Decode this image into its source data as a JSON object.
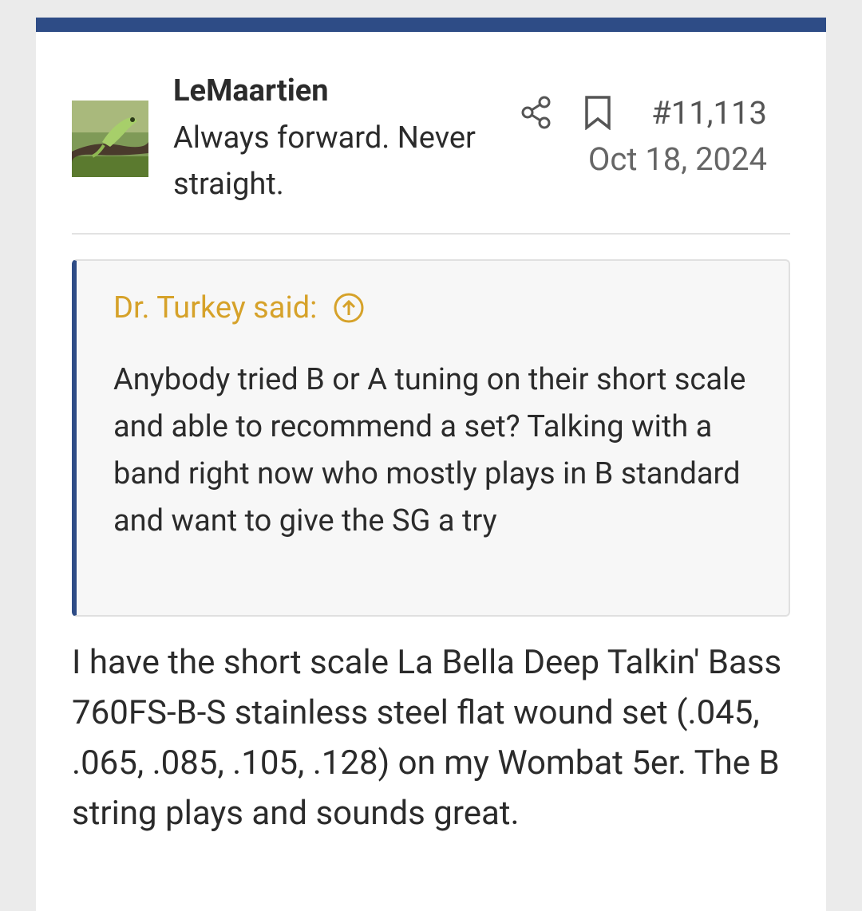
{
  "post": {
    "username": "LeMaartien",
    "user_title": "Always forward. Never straight.",
    "post_number": "#11,113",
    "date": "Oct 18, 2024",
    "icons": {
      "share": "share-icon",
      "bookmark": "bookmark-icon"
    },
    "accent_color": "#2e4c86"
  },
  "quote": {
    "attribution": "Dr. Turkey said:",
    "attribution_color": "#d6a22a",
    "icon": "arrow-up-circle-icon",
    "text": "Anybody tried B or A tuning on their short scale and able to recommend a set? Talking with a band right now who mostly plays in B standard and want to give the SG a try"
  },
  "body": {
    "text": "I have the short scale La Bella Deep Talkin' Bass 760FS-B-S stainless steel flat wound set (.045, .065, .085, .105, .128) on my Wombat 5er. The B string plays and sounds great."
  }
}
